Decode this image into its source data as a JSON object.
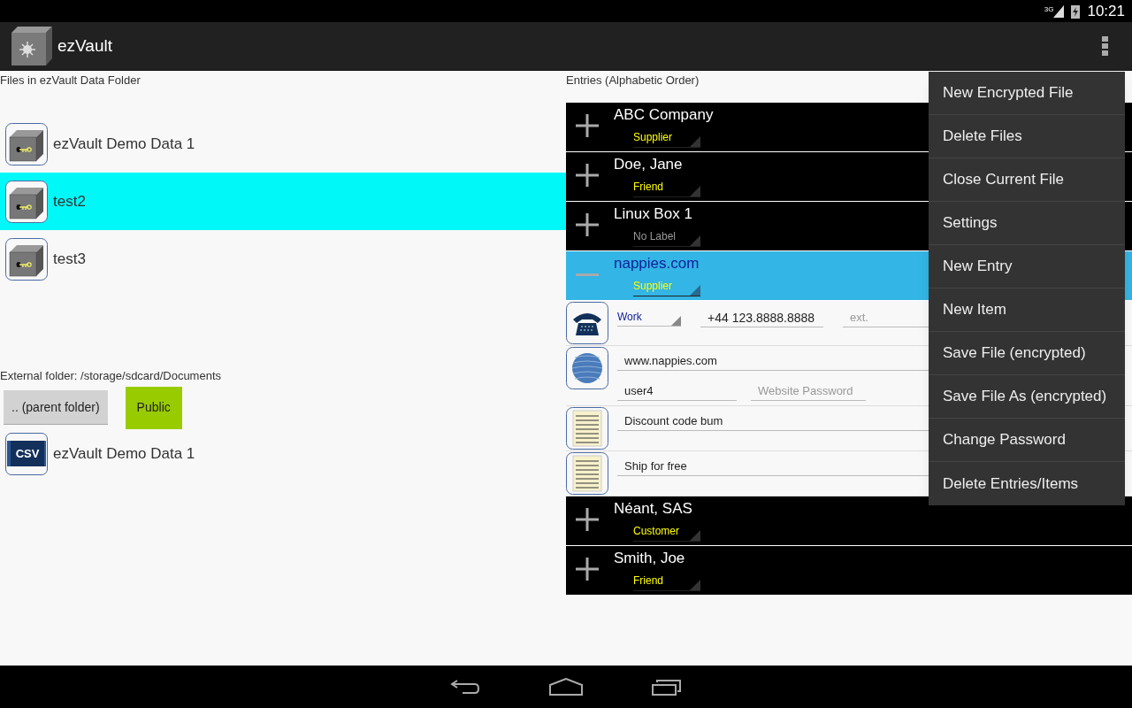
{
  "status_bar": {
    "network": "3G",
    "time": "10:21"
  },
  "action_bar": {
    "title": "ezVault"
  },
  "files_panel": {
    "heading": "Files in ezVault Data Folder",
    "files": [
      {
        "name": "ezVault Demo Data 1",
        "selected": false
      },
      {
        "name": "test2",
        "selected": true
      },
      {
        "name": "test3",
        "selected": false
      }
    ],
    "external_folder": "External folder: /storage/sdcard/Documents",
    "buttons": [
      {
        "label": ".. (parent folder)",
        "kind": "plain"
      },
      {
        "label": "Public",
        "kind": "folder"
      }
    ],
    "external_files": [
      {
        "name": "ezVault Demo Data 1",
        "kind": "csv",
        "icon_text": "CSV"
      }
    ]
  },
  "entries_panel": {
    "heading": "Entries (Alphabetic Order)",
    "entries": [
      {
        "name": "ABC Company",
        "label": "Supplier",
        "label_set": true,
        "expanded": false
      },
      {
        "name": "Doe, Jane",
        "label": "Friend",
        "label_set": true,
        "expanded": false
      },
      {
        "name": "Linux Box 1",
        "label": "No Label",
        "label_set": false,
        "expanded": false
      },
      {
        "name": "nappies.com",
        "label": "Supplier",
        "label_set": true,
        "expanded": true,
        "items": [
          {
            "kind": "phone",
            "type": "Work",
            "number": "+44 123.8888.8888",
            "ext_placeholder": "ext."
          },
          {
            "kind": "web",
            "url": "www.nappies.com",
            "username": "user4",
            "password_placeholder": "Website Password"
          },
          {
            "kind": "note",
            "text": "Discount code bum"
          },
          {
            "kind": "note",
            "text": "Ship for free"
          }
        ]
      },
      {
        "name": "Néant, SAS",
        "label": "Customer",
        "label_set": true,
        "expanded": false
      },
      {
        "name": "Smith, Joe",
        "label": "Friend",
        "label_set": true,
        "expanded": false
      }
    ]
  },
  "menu": {
    "items": [
      "New Encrypted File",
      "Delete Files",
      "Close Current File",
      "Settings",
      "New Entry",
      "New Item",
      "Save File (encrypted)",
      "Save File As (encrypted)",
      "Change Password",
      "Delete Entries/Items"
    ]
  }
}
